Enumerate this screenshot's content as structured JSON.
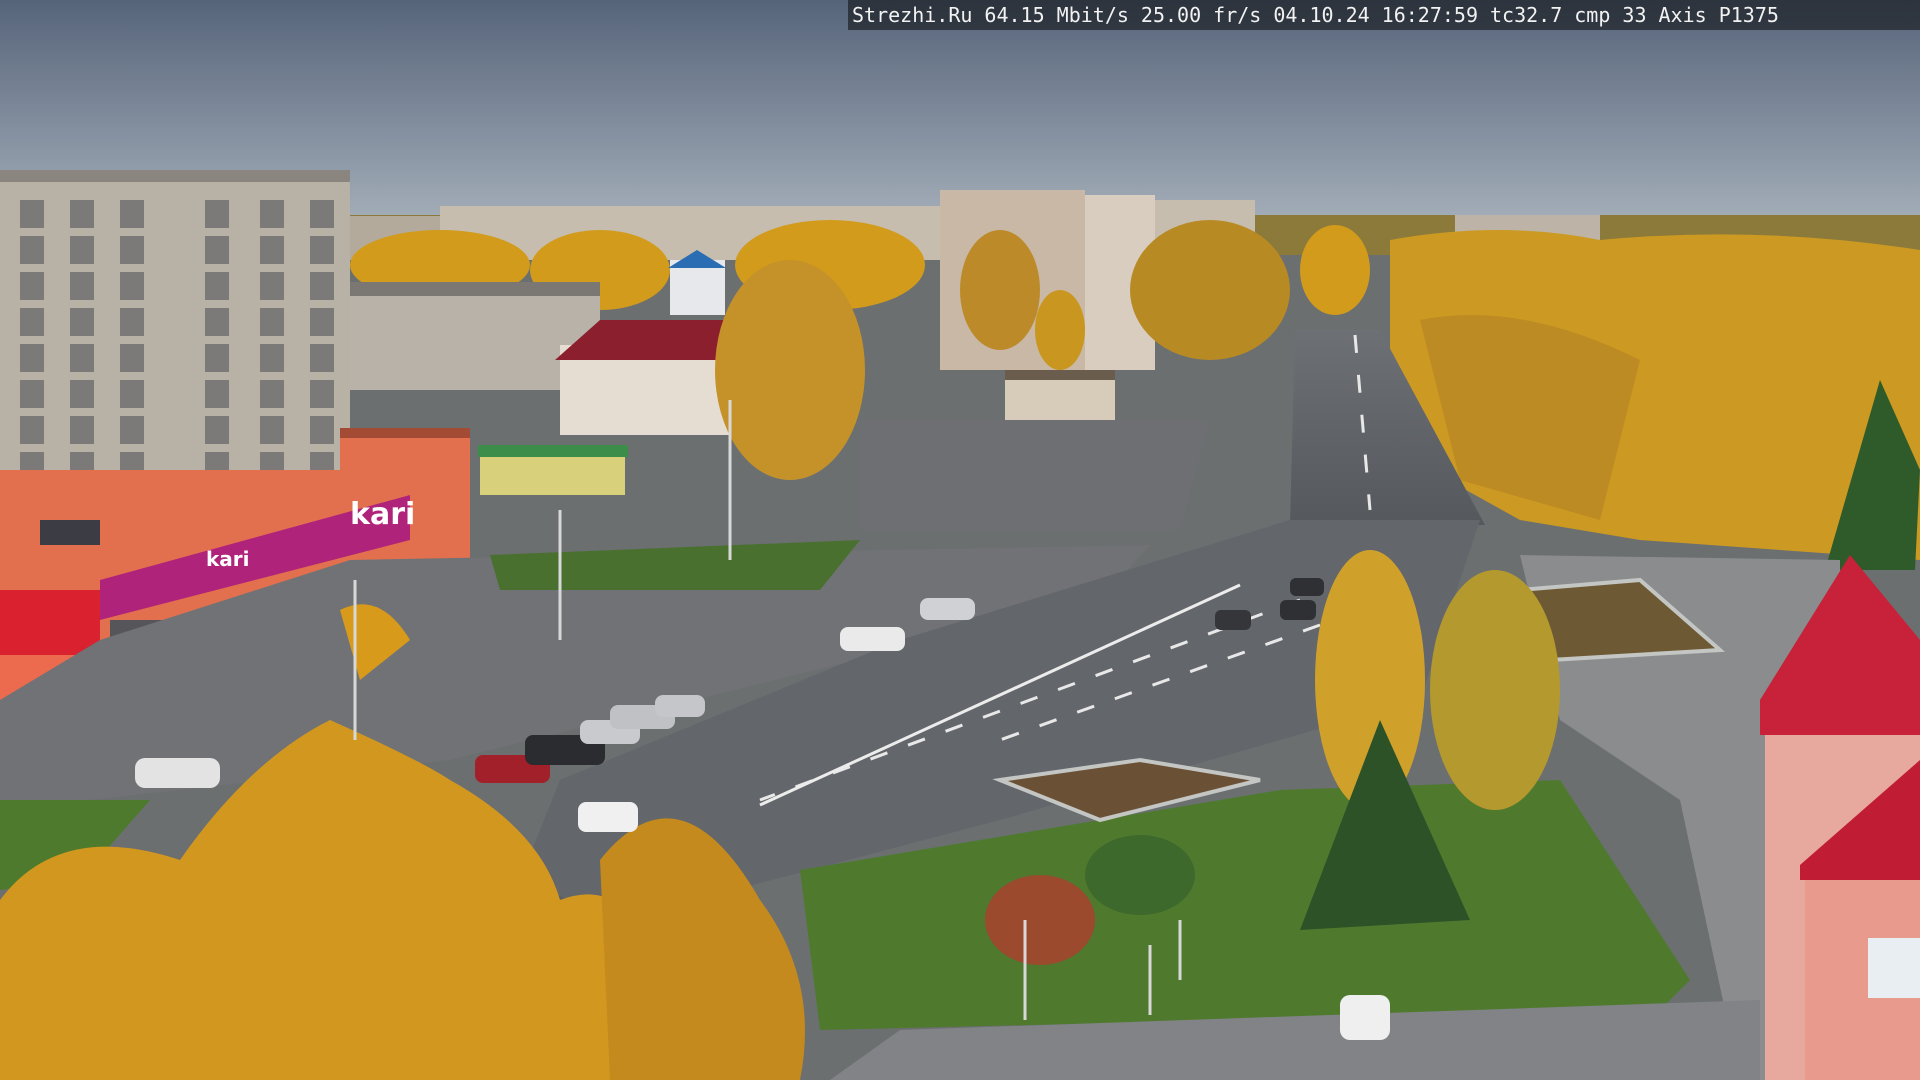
{
  "camera_overlay": {
    "site": "Strezhi.Ru",
    "bitrate": "64.15 Mbit/s",
    "framerate": "25.00 fr/s",
    "date": "04.10.24",
    "time": "16:27:59",
    "tc": "tc32.7",
    "cmp": "cmp 33",
    "camera_model": "Axis P1375"
  },
  "storefront_signs": {
    "main_logo": "kari",
    "banner_small": "kari"
  },
  "colors": {
    "sky_top": "#5d6b7b",
    "sky_horizon": "#a9b4bf",
    "foliage_yellow": "#d9a21e",
    "road": "#5e6166",
    "grass": "#4f7a2e",
    "store_orange": "#e2704f",
    "store_magenta": "#b0237a",
    "roof_red": "#c8223a"
  }
}
